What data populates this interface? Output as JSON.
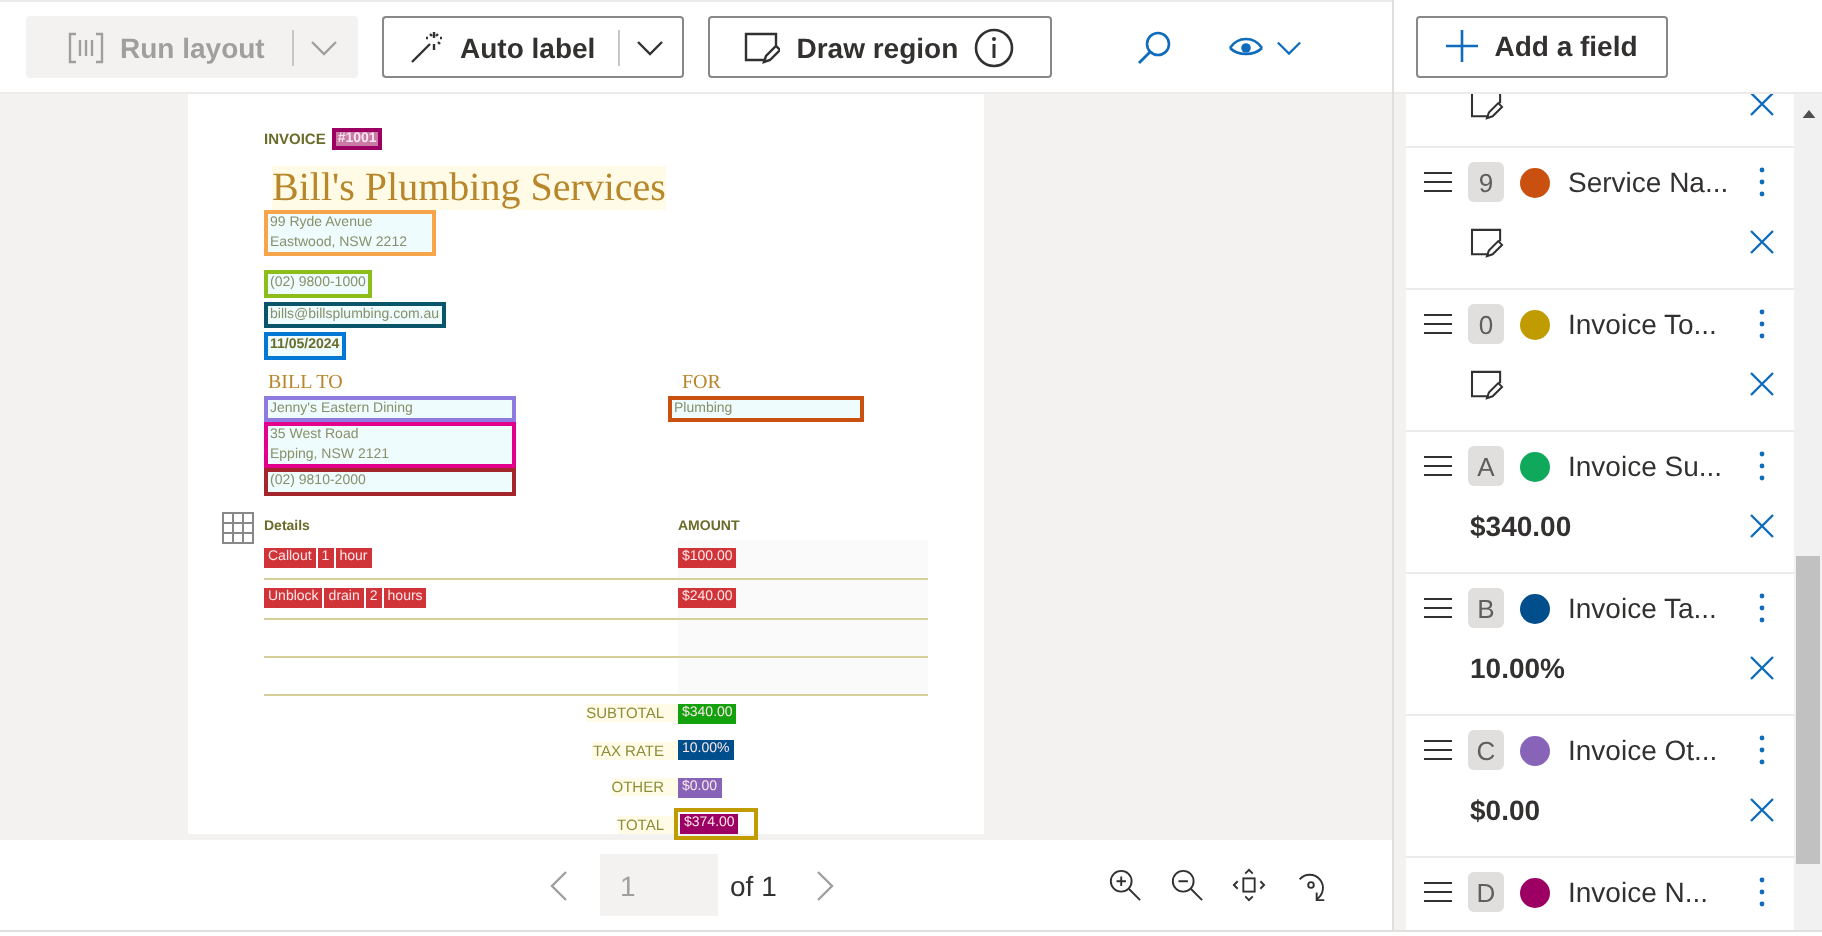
{
  "toolbar": {
    "run_layout": {
      "label": "Run layout",
      "disabled": true
    },
    "auto_label": {
      "label": "Auto label"
    },
    "draw_region": {
      "label": "Draw region"
    }
  },
  "document": {
    "invoice_label": "INVOICE",
    "invoice_number": {
      "text": "#1001",
      "color": "#9b0062"
    },
    "company": "Bill's Plumbing Services",
    "header_fields": [
      {
        "lines": [
          "99 Ryde Avenue",
          "Eastwood, NSW 2212"
        ],
        "color": "#f7a54a",
        "bold": false
      },
      {
        "lines": [
          "(02) 9800-1000"
        ],
        "color": "#8cbd18",
        "bold": false
      },
      {
        "lines": [
          "bills@billsplumbing.com.au"
        ],
        "color": "#0b556a",
        "bold": false
      },
      {
        "lines": [
          "11/05/2024"
        ],
        "color": "#0078d4",
        "bold": true
      }
    ],
    "bill_to": {
      "heading": "BILL TO",
      "fields": [
        {
          "lines": [
            "Jenny's Eastern Dining"
          ],
          "color": "#8f7ae0",
          "bold": false
        },
        {
          "lines": [
            "35 West Road",
            "Epping, NSW 2121"
          ],
          "color": "#e3008c",
          "bold": false
        },
        {
          "lines": [
            "(02) 9810-2000"
          ],
          "color": "#a4262c",
          "bold": false
        }
      ]
    },
    "for": {
      "heading": "FOR",
      "fields": [
        {
          "lines": [
            "Plumbing"
          ],
          "color": "#ca5010",
          "bold": false
        }
      ]
    },
    "table": {
      "color": "#d13438",
      "columns": [
        "Details",
        "AMOUNT"
      ],
      "rows": [
        {
          "details": [
            "Callout",
            "1",
            "hour"
          ],
          "amount": "$100.00"
        },
        {
          "details": [
            "Unblock",
            "drain",
            "2",
            "hours"
          ],
          "amount": "$240.00"
        }
      ]
    },
    "totals": [
      {
        "label": "SUBTOTAL",
        "value": "$340.00",
        "color": "#13a10e"
      },
      {
        "label": "TAX RATE",
        "value": "10.00%",
        "color": "#004e8c"
      },
      {
        "label": "OTHER",
        "value": "$0.00",
        "color": "#8764b8"
      },
      {
        "label": "TOTAL",
        "value": "$374.00",
        "color": "#9b0062",
        "region": {
          "color": "#c19c00"
        }
      }
    ]
  },
  "pager": {
    "page": "1",
    "of": "of 1"
  },
  "panel": {
    "add_button": "Add a field",
    "fields": [
      {
        "kind": "clipped"
      },
      {
        "kind": "full",
        "key": "9",
        "color": "#ca5010",
        "name": "Service Na..."
      },
      {
        "kind": "full",
        "key": "0",
        "color": "#c19c00",
        "name": "Invoice To..."
      },
      {
        "kind": "full",
        "key": "A",
        "color": "#10a85a",
        "name": "Invoice Su...",
        "value": "$340.00"
      },
      {
        "kind": "full",
        "key": "B",
        "color": "#004e8c",
        "name": "Invoice Ta...",
        "value": "10.00%"
      },
      {
        "kind": "full",
        "key": "C",
        "color": "#8764b8",
        "name": "Invoice Ot...",
        "value": "$0.00"
      },
      {
        "kind": "full",
        "key": "D",
        "color": "#9b0062",
        "name": "Invoice N..."
      }
    ]
  }
}
